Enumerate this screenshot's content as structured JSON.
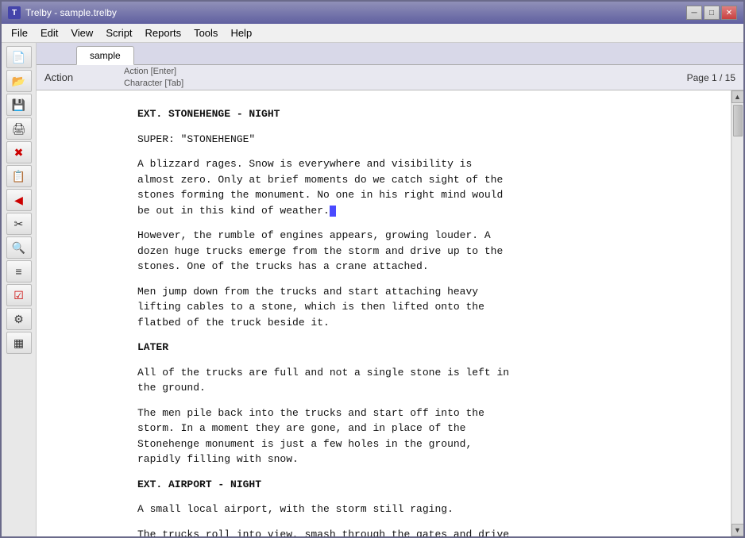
{
  "window": {
    "title": "Trelby - sample.trelby",
    "icon": "T"
  },
  "title_buttons": {
    "minimize": "─",
    "maximize": "□",
    "close": "✕"
  },
  "menu": {
    "items": [
      "File",
      "Edit",
      "View",
      "Script",
      "Reports",
      "Tools",
      "Help"
    ]
  },
  "tab": {
    "label": "sample"
  },
  "toolbar": {
    "buttons": [
      {
        "name": "new-doc",
        "icon": "📄"
      },
      {
        "name": "open-doc",
        "icon": "📂"
      },
      {
        "name": "save-doc",
        "icon": "💾"
      },
      {
        "name": "print-doc",
        "icon": "🖨"
      },
      {
        "name": "delete",
        "icon": "✖"
      },
      {
        "name": "format",
        "icon": "📝"
      },
      {
        "name": "red-arrow",
        "icon": "◀"
      },
      {
        "name": "cut",
        "icon": "✂"
      },
      {
        "name": "search",
        "icon": "🔍"
      },
      {
        "name": "list",
        "icon": "≡"
      },
      {
        "name": "checklist",
        "icon": "☑"
      },
      {
        "name": "settings",
        "icon": "⚙"
      },
      {
        "name": "grid",
        "icon": "▦"
      }
    ]
  },
  "status_bar": {
    "element_type": "Action",
    "shortcuts_line1": "Action [Enter]",
    "shortcuts_line2": "Character [Tab]",
    "page_info": "Page 1 / 15"
  },
  "script": {
    "lines": [
      {
        "type": "scene-heading",
        "text": "EXT. STONEHENGE - NIGHT"
      },
      {
        "type": "action",
        "text": "SUPER: \"STONEHENGE\""
      },
      {
        "type": "action",
        "text": "A blizzard rages. Snow is everywhere and visibility is\nalmost zero. Only at brief moments do we catch sight of the\nstones forming the monument. No one in his right mind would\nbe out in this kind of weather.",
        "cursor": true
      },
      {
        "type": "action",
        "text": "However, the rumble of engines appears, growing louder. A\ndozen huge trucks emerge from the storm and drive up to the\nstones. One of the trucks has a crane attached."
      },
      {
        "type": "action",
        "text": "Men jump down from the trucks and start attaching heavy\nlifting cables to a stone, which is then lifted onto the\nflatbed of the truck beside it."
      },
      {
        "type": "scene-heading",
        "text": "LATER"
      },
      {
        "type": "action",
        "text": "All of the trucks are full and not a single stone is left in\nthe ground."
      },
      {
        "type": "action",
        "text": "The men pile back into the trucks and start off into the\nstorm. In a moment they are gone, and in place of the\nStonehenge monument is just a few holes in the ground,\nrapidly filling with snow."
      },
      {
        "type": "scene-heading",
        "text": "EXT. AIRPORT - NIGHT"
      },
      {
        "type": "action",
        "text": "A small local airport, with the storm still raging."
      },
      {
        "type": "action",
        "text": "The trucks roll into view, smash through the gates and drive"
      }
    ]
  }
}
